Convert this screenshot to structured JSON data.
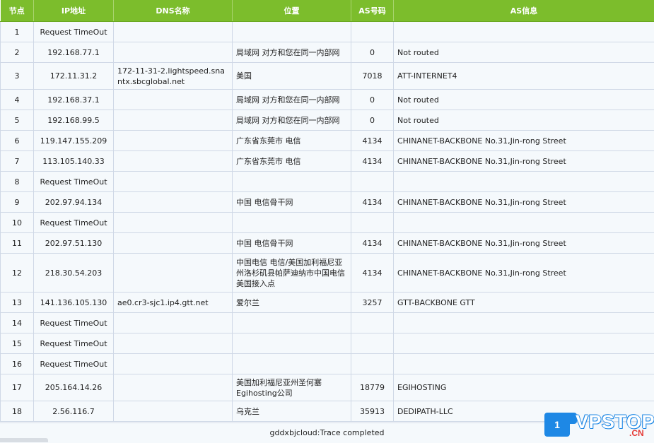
{
  "table": {
    "headers": [
      "节点",
      "IP地址",
      "DNS名称",
      "位置",
      "AS号码",
      "AS信息"
    ],
    "rows": [
      {
        "hop": "1",
        "ip": "Request TimeOut",
        "dns": "",
        "loc": "",
        "as": "",
        "info": ""
      },
      {
        "hop": "2",
        "ip": "192.168.77.1",
        "dns": "",
        "loc": "局域网 对方和您在同一内部网",
        "as": "0",
        "info": "Not routed"
      },
      {
        "hop": "3",
        "ip": "172.11.31.2",
        "dns": "172-11-31-2.lightspeed.snantx.sbcglobal.net",
        "loc": "美国",
        "as": "7018",
        "info": "ATT-INTERNET4"
      },
      {
        "hop": "4",
        "ip": "192.168.37.1",
        "dns": "",
        "loc": "局域网 对方和您在同一内部网",
        "as": "0",
        "info": "Not routed"
      },
      {
        "hop": "5",
        "ip": "192.168.99.5",
        "dns": "",
        "loc": "局域网 对方和您在同一内部网",
        "as": "0",
        "info": "Not routed"
      },
      {
        "hop": "6",
        "ip": "119.147.155.209",
        "dns": "",
        "loc": "广东省东莞市 电信",
        "as": "4134",
        "info": "CHINANET-BACKBONE No.31,Jin-rong Street"
      },
      {
        "hop": "7",
        "ip": "113.105.140.33",
        "dns": "",
        "loc": "广东省东莞市 电信",
        "as": "4134",
        "info": "CHINANET-BACKBONE No.31,Jin-rong Street"
      },
      {
        "hop": "8",
        "ip": "Request TimeOut",
        "dns": "",
        "loc": "",
        "as": "",
        "info": ""
      },
      {
        "hop": "9",
        "ip": "202.97.94.134",
        "dns": "",
        "loc": "中国 电信骨干网",
        "as": "4134",
        "info": "CHINANET-BACKBONE No.31,Jin-rong Street"
      },
      {
        "hop": "10",
        "ip": "Request TimeOut",
        "dns": "",
        "loc": "",
        "as": "",
        "info": ""
      },
      {
        "hop": "11",
        "ip": "202.97.51.130",
        "dns": "",
        "loc": "中国 电信骨干网",
        "as": "4134",
        "info": "CHINANET-BACKBONE No.31,Jin-rong Street"
      },
      {
        "hop": "12",
        "ip": "218.30.54.203",
        "dns": "",
        "loc": "中国电信 电信/美国加利福尼亚州洛杉矶县帕萨迪纳市中国电信美国接入点",
        "as": "4134",
        "info": "CHINANET-BACKBONE No.31,Jin-rong Street"
      },
      {
        "hop": "13",
        "ip": "141.136.105.130",
        "dns": "ae0.cr3-sjc1.ip4.gtt.net",
        "loc": "爱尔兰",
        "as": "3257",
        "info": "GTT-BACKBONE GTT"
      },
      {
        "hop": "14",
        "ip": "Request TimeOut",
        "dns": "",
        "loc": "",
        "as": "",
        "info": ""
      },
      {
        "hop": "15",
        "ip": "Request TimeOut",
        "dns": "",
        "loc": "",
        "as": "",
        "info": ""
      },
      {
        "hop": "16",
        "ip": "Request TimeOut",
        "dns": "",
        "loc": "",
        "as": "",
        "info": ""
      },
      {
        "hop": "17",
        "ip": "205.164.14.26",
        "dns": "",
        "loc": "美国加利福尼亚州圣何塞 Egihosting公司",
        "as": "18779",
        "info": "EGIHOSTING"
      },
      {
        "hop": "18",
        "ip": "2.56.116.7",
        "dns": "",
        "loc": "乌克兰",
        "as": "35913",
        "info": "DEDIPATH-LLC"
      }
    ]
  },
  "footer": {
    "status": "gddxbjcloud:Trace completed"
  },
  "watermark": {
    "badge": "1",
    "brand": "VPSTOP",
    "tld": ".CN"
  },
  "colors": {
    "header": "#7cbd2c",
    "cell": "#f5f9fc",
    "border": "#cfd8e6",
    "logo_blue": "#1e88e5",
    "logo_red": "#e53935"
  }
}
